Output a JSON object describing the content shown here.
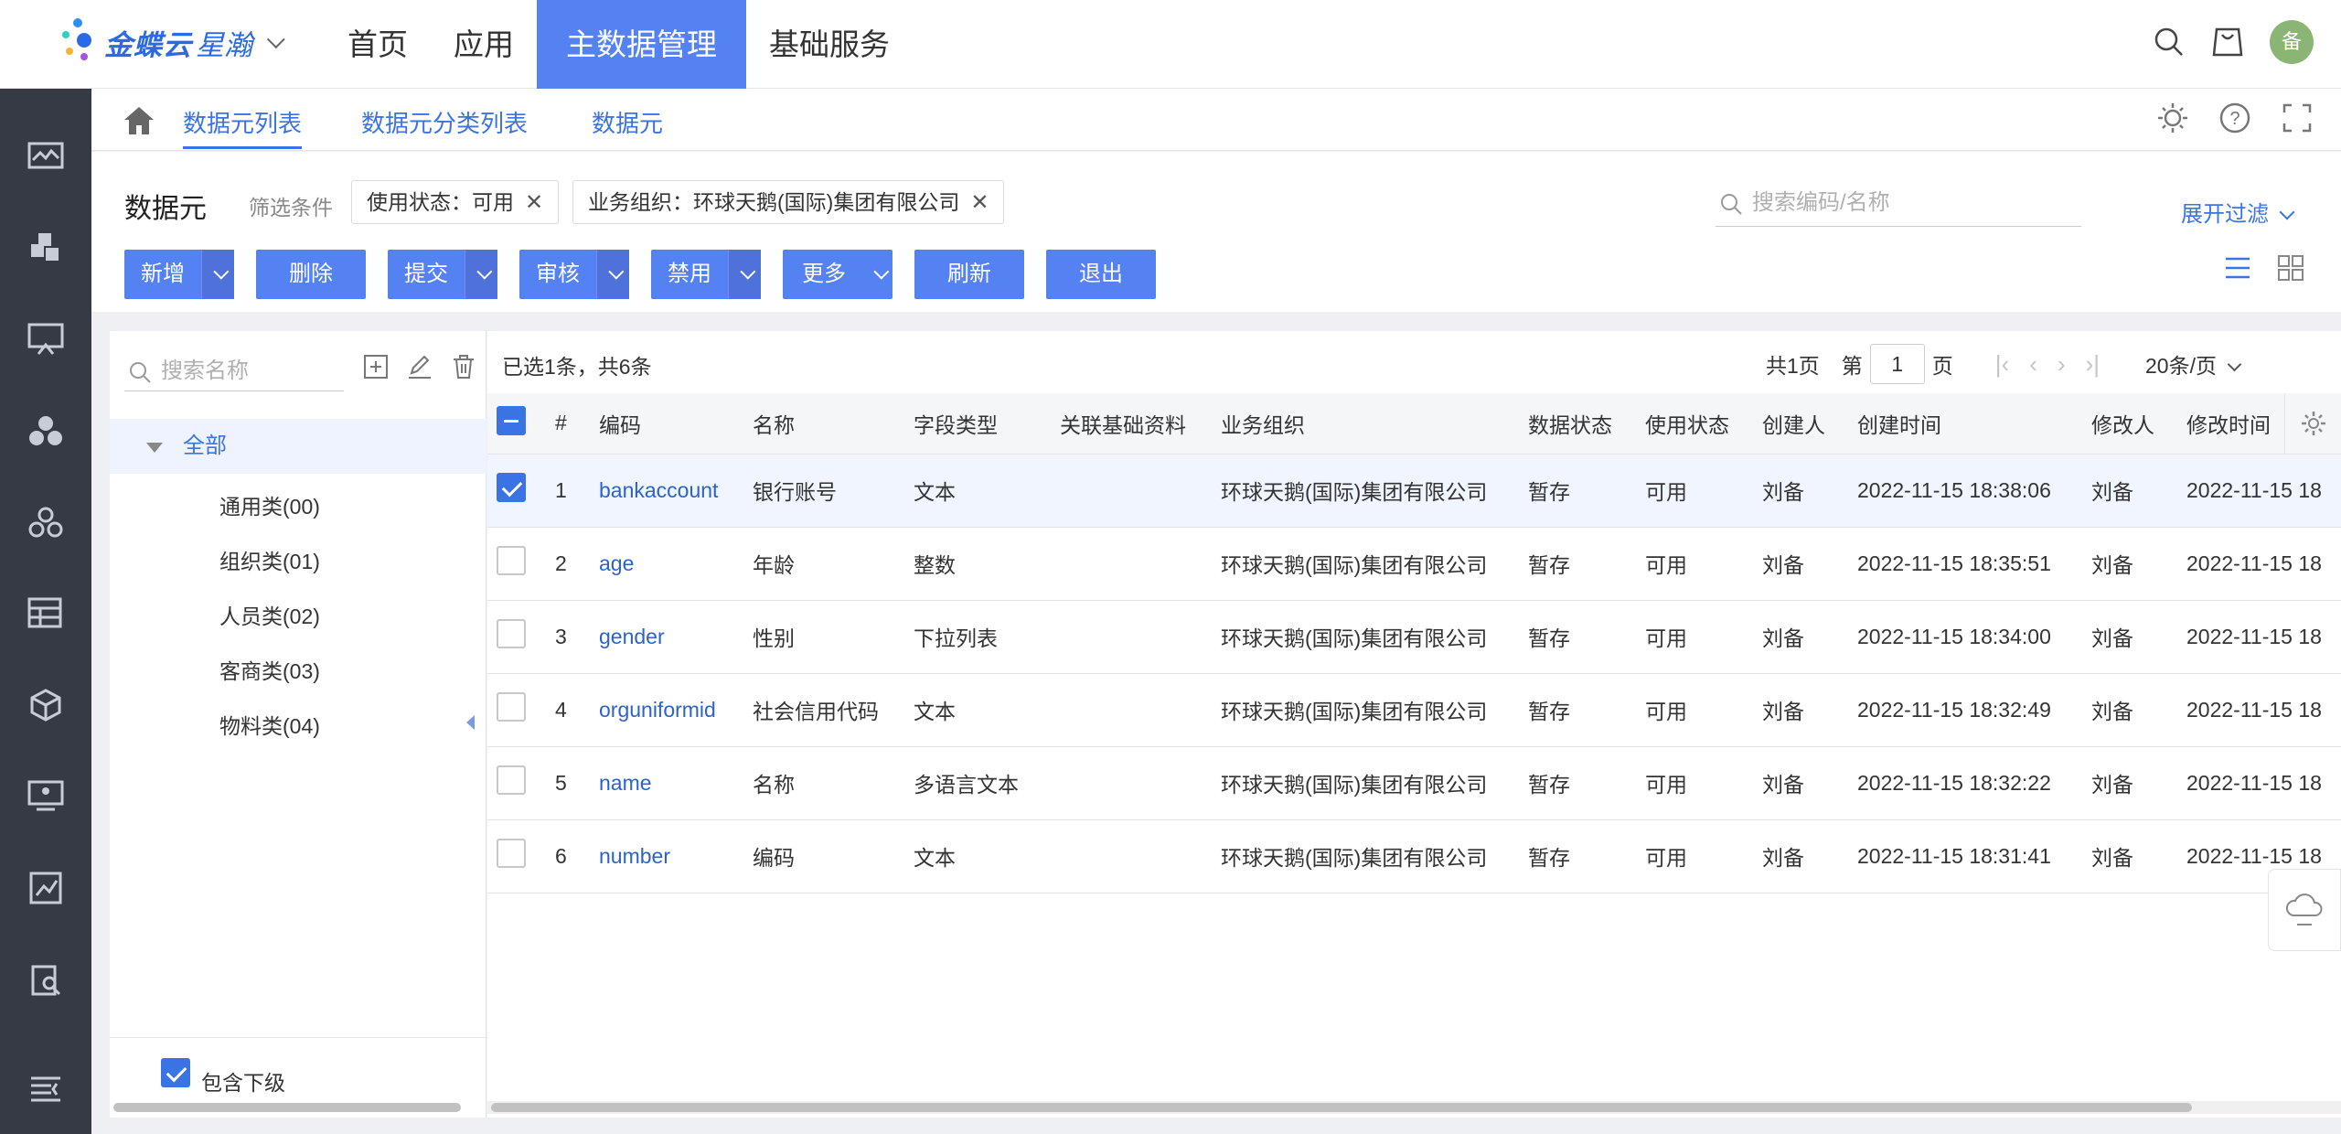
{
  "brand": {
    "name": "金蝶云",
    "sub": "星瀚"
  },
  "nav": [
    "首页",
    "应用",
    "主数据管理",
    "基础服务"
  ],
  "nav_active": 2,
  "user": {
    "avatar": "备"
  },
  "tabs": [
    "数据元列表",
    "数据元分类列表",
    "数据元"
  ],
  "page": {
    "title": "数据元",
    "filter_label": "筛选条件",
    "chips": [
      "使用状态：可用",
      "业务组织：环球天鹅(国际)集团有限公司"
    ],
    "search_placeholder": "搜索编码/名称",
    "expand_filter": "展开过滤"
  },
  "toolbar": {
    "add": "新增",
    "delete": "删除",
    "submit": "提交",
    "audit": "审核",
    "disable": "禁用",
    "more": "更多",
    "refresh": "刷新",
    "exit": "退出"
  },
  "tree": {
    "search_placeholder": "搜索名称",
    "root": "全部",
    "nodes": [
      "通用类(00)",
      "组织类(01)",
      "人员类(02)",
      "客商类(03)",
      "物料类(04)"
    ],
    "include_sub": "包含下级"
  },
  "grid": {
    "summary": "已选1条，共6条",
    "pager": {
      "total": "共1页",
      "prefix": "第",
      "page": "1",
      "suffix": "页",
      "page_size": "20条/页"
    },
    "columns": [
      "#",
      "编码",
      "名称",
      "字段类型",
      "关联基础资料",
      "业务组织",
      "数据状态",
      "使用状态",
      "创建人",
      "创建时间",
      "修改人",
      "修改时间"
    ],
    "rows": [
      {
        "no": "1",
        "code": "bankaccount",
        "name": "银行账号",
        "type": "文本",
        "ref": "",
        "org": "环球天鹅(国际)集团有限公司",
        "data_status": "暂存",
        "use_status": "可用",
        "creator": "刘备",
        "created": "2022-11-15 18:38:06",
        "modifier": "刘备",
        "modified": "2022-11-15 18",
        "selected": true
      },
      {
        "no": "2",
        "code": "age",
        "name": "年龄",
        "type": "整数",
        "ref": "",
        "org": "环球天鹅(国际)集团有限公司",
        "data_status": "暂存",
        "use_status": "可用",
        "creator": "刘备",
        "created": "2022-11-15 18:35:51",
        "modifier": "刘备",
        "modified": "2022-11-15 18",
        "selected": false
      },
      {
        "no": "3",
        "code": "gender",
        "name": "性别",
        "type": "下拉列表",
        "ref": "",
        "org": "环球天鹅(国际)集团有限公司",
        "data_status": "暂存",
        "use_status": "可用",
        "creator": "刘备",
        "created": "2022-11-15 18:34:00",
        "modifier": "刘备",
        "modified": "2022-11-15 18",
        "selected": false
      },
      {
        "no": "4",
        "code": "orguniformid",
        "name": "社会信用代码",
        "type": "文本",
        "ref": "",
        "org": "环球天鹅(国际)集团有限公司",
        "data_status": "暂存",
        "use_status": "可用",
        "creator": "刘备",
        "created": "2022-11-15 18:32:49",
        "modifier": "刘备",
        "modified": "2022-11-15 18",
        "selected": false
      },
      {
        "no": "5",
        "code": "name",
        "name": "名称",
        "type": "多语言文本",
        "ref": "",
        "org": "环球天鹅(国际)集团有限公司",
        "data_status": "暂存",
        "use_status": "可用",
        "creator": "刘备",
        "created": "2022-11-15 18:32:22",
        "modifier": "刘备",
        "modified": "2022-11-15 18",
        "selected": false
      },
      {
        "no": "6",
        "code": "number",
        "name": "编码",
        "type": "文本",
        "ref": "",
        "org": "环球天鹅(国际)集团有限公司",
        "data_status": "暂存",
        "use_status": "可用",
        "creator": "刘备",
        "created": "2022-11-15 18:31:41",
        "modifier": "刘备",
        "modified": "2022-11-15 18",
        "selected": false
      }
    ]
  },
  "colors": {
    "primary": "#5582f3",
    "link": "#3a73e4",
    "sidebar": "#353a45"
  }
}
